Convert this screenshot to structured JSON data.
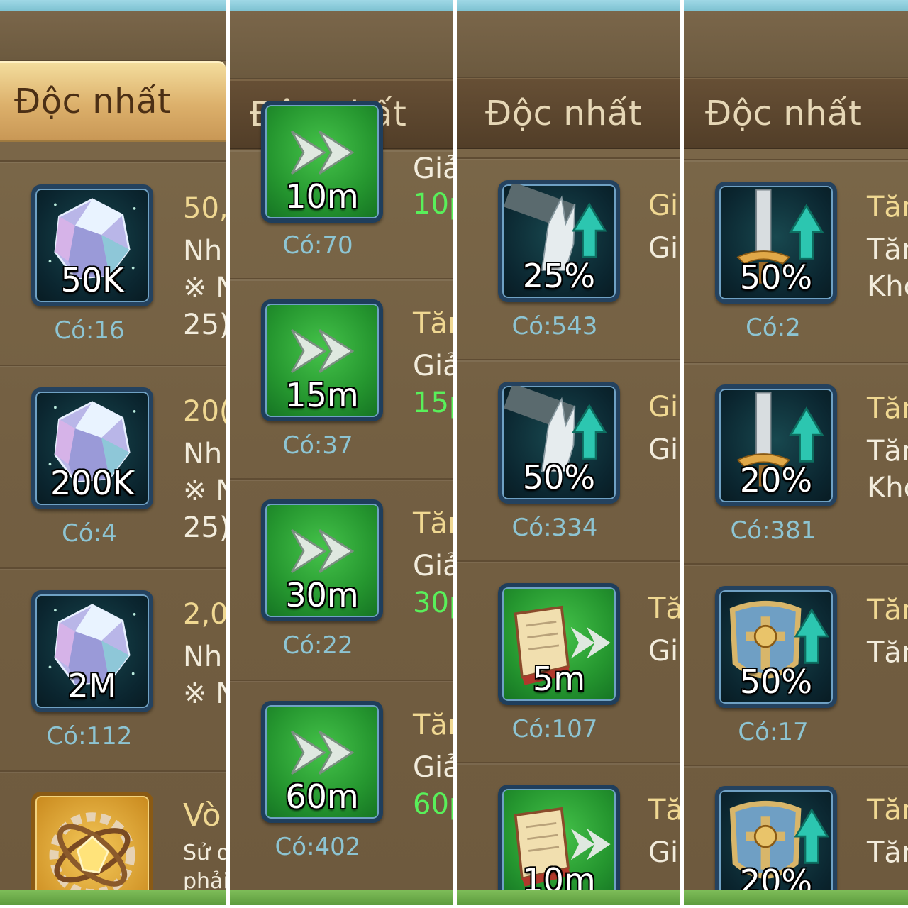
{
  "panels": [
    {
      "tab": "Độc nhất",
      "items": [
        {
          "qty": "50K",
          "have": "Có:16",
          "lines": [
            "50,",
            "Nh",
            "※ N",
            "25)"
          ]
        },
        {
          "qty": "200K",
          "have": "Có:4",
          "lines": [
            "20(",
            "Nh",
            "※ N",
            "25)"
          ]
        },
        {
          "qty": "2M",
          "have": "Có:112",
          "lines": [
            "2,0",
            "Nh",
            "※ N"
          ]
        },
        {
          "qty": "",
          "have": "",
          "lines": [
            "Vò",
            "Sử d",
            "phải"
          ]
        }
      ]
    },
    {
      "tab": "Độc nhất",
      "items": [
        {
          "qty": "10m",
          "have": "Có:70",
          "lines": [
            "Giả",
            "10p"
          ]
        },
        {
          "qty": "15m",
          "have": "Có:37",
          "lines": [
            "Tăr",
            "Giả",
            "15p"
          ]
        },
        {
          "qty": "30m",
          "have": "Có:22",
          "lines": [
            "Tăr",
            "Giả",
            "30p"
          ]
        },
        {
          "qty": "60m",
          "have": "Có:402",
          "lines": [
            "Tăr",
            "Giả",
            "60p"
          ]
        }
      ]
    },
    {
      "tab": "Độc nhất",
      "items": [
        {
          "qty": "25%",
          "have": "Có:543",
          "lines": [
            "Gi",
            "Gi"
          ]
        },
        {
          "qty": "50%",
          "have": "Có:334",
          "lines": [
            "Gi",
            "Gi"
          ]
        },
        {
          "qty": "5m",
          "have": "Có:107",
          "lines": [
            "Tă",
            "Gi"
          ]
        },
        {
          "qty": "10m",
          "have": "",
          "lines": [
            "Tă",
            "Gi"
          ]
        }
      ]
    },
    {
      "tab": "Độc nhất",
      "items": [
        {
          "qty": "50%",
          "have": "Có:2",
          "lines": [
            "Tăr",
            "Tăr",
            "Khc"
          ]
        },
        {
          "qty": "20%",
          "have": "Có:381",
          "lines": [
            "Tăr",
            "Tăr",
            "Khc"
          ]
        },
        {
          "qty": "50%",
          "have": "Có:17",
          "lines": [
            "Tăr",
            "Tăr"
          ]
        },
        {
          "qty": "20%",
          "have": "",
          "lines": [
            "Tăr",
            "Tăr"
          ]
        }
      ]
    }
  ],
  "colors": {
    "title": "#f0d892",
    "text": "#f2ecdc",
    "speed": "#59f05a",
    "have": "#8dc4d2"
  },
  "icons": [
    "gem-icon",
    "speedup-arrow-icon",
    "wing-boot-icon",
    "research-book-icon",
    "sword-buff-icon",
    "shield-buff-icon",
    "gold-gear-relic-icon"
  ]
}
